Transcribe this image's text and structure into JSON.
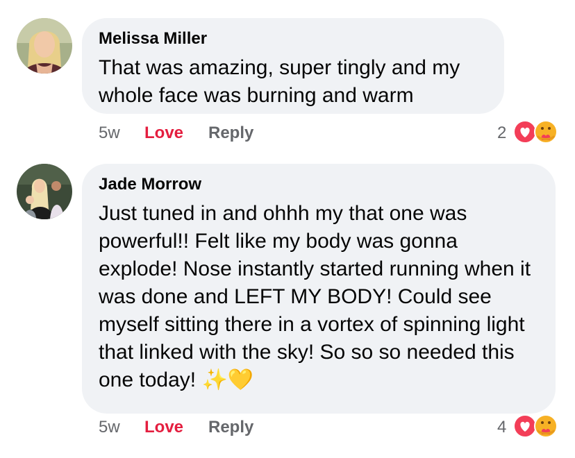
{
  "comments": [
    {
      "author": "Melissa Miller",
      "text": "That was amazing, super tingly and my whole face was burning and warm",
      "age": "5w",
      "love_label": "Love",
      "reply_label": "Reply",
      "reaction_count": "2",
      "reactions": [
        "love-reaction",
        "care-reaction"
      ]
    },
    {
      "author": "Jade Morrow",
      "text": "Just tuned in and ohhh my that one was powerful!! Felt like my body was gonna explode! Nose instantly started running when it was done and LEFT MY BODY! Could see myself sitting there in a vortex of spinning light that linked with the sky! So so so needed this one today! ✨💛",
      "age": "5w",
      "love_label": "Love",
      "reply_label": "Reply",
      "reaction_count": "4",
      "reactions": [
        "love-reaction",
        "care-reaction"
      ]
    }
  ],
  "colors": {
    "bubble": "#f0f2f5",
    "love_active": "#e41e3f",
    "meta": "#65676b",
    "text": "#050505"
  }
}
